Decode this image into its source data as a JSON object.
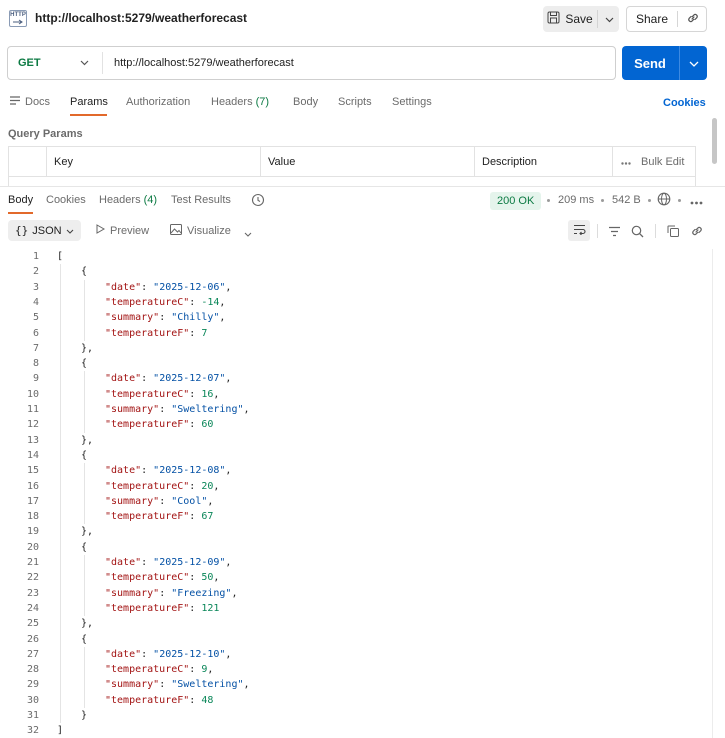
{
  "header": {
    "badge": "HTTP",
    "title": "http://localhost:5279/weatherforecast",
    "save_label": "Save",
    "share_label": "Share"
  },
  "request": {
    "method": "GET",
    "url": "http://localhost:5279/weatherforecast",
    "send_label": "Send"
  },
  "request_tabs": [
    {
      "label": "Docs"
    },
    {
      "label": "Params"
    },
    {
      "label": "Authorization"
    },
    {
      "label": "Headers",
      "count": "(7)"
    },
    {
      "label": "Body"
    },
    {
      "label": "Scripts"
    },
    {
      "label": "Settings"
    }
  ],
  "cookies_link": "Cookies",
  "query_params": {
    "title": "Query Params",
    "columns": [
      "Key",
      "Value",
      "Description"
    ],
    "bulk_edit": "Bulk Edit"
  },
  "response_tabs": [
    {
      "label": "Body"
    },
    {
      "label": "Cookies"
    },
    {
      "label": "Headers",
      "count": "(4)"
    },
    {
      "label": "Test Results"
    }
  ],
  "response_meta": {
    "status": "200 OK",
    "time": "209 ms",
    "size": "542 B"
  },
  "response_toolbar": {
    "format": "JSON",
    "preview": "Preview",
    "visualize": "Visualize"
  },
  "response_body": [
    {
      "date": "2025-12-06",
      "temperatureC": -14,
      "summary": "Chilly",
      "temperatureF": 7
    },
    {
      "date": "2025-12-07",
      "temperatureC": 16,
      "summary": "Sweltering",
      "temperatureF": 60
    },
    {
      "date": "2025-12-08",
      "temperatureC": 20,
      "summary": "Cool",
      "temperatureF": 67
    },
    {
      "date": "2025-12-09",
      "temperatureC": 50,
      "summary": "Freezing",
      "temperatureF": 121
    },
    {
      "date": "2025-12-10",
      "temperatureC": 9,
      "summary": "Sweltering",
      "temperatureF": 48
    }
  ],
  "colors": {
    "accent": "#0265d2",
    "active_tab": "#e2692b",
    "method_get": "#0c7a43",
    "json_key": "#a31515",
    "json_string": "#0451a5",
    "json_number": "#098658"
  }
}
